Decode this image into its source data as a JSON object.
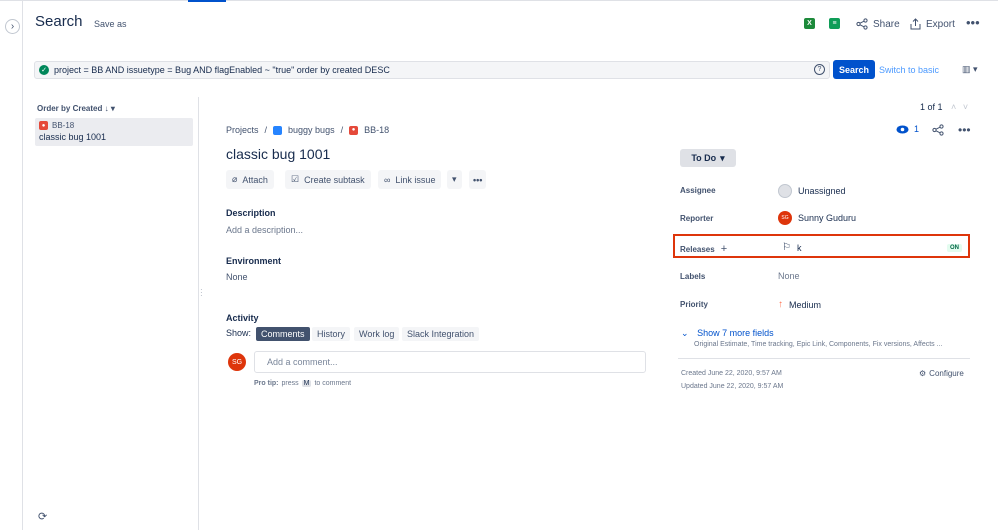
{
  "header": {
    "title": "Search",
    "save_as": "Save as",
    "share": "Share",
    "export": "Export"
  },
  "jql": {
    "query": "project = BB AND issuetype = Bug AND flagEnabled ~ \"true\" order by created DESC",
    "search_label": "Search",
    "switch_label": "Switch to basic"
  },
  "list": {
    "order_by": "Order by Created",
    "items": [
      {
        "key": "BB-18",
        "summary": "classic bug 1001"
      }
    ]
  },
  "pagination": "1 of 1",
  "issue": {
    "breadcrumb": [
      "Projects",
      "buggy bugs",
      "BB-18"
    ],
    "title": "classic bug 1001",
    "watchers": "1",
    "actions": {
      "attach": "Attach",
      "create_subtask": "Create subtask",
      "link_issue": "Link issue"
    },
    "description_label": "Description",
    "description_placeholder": "Add a description...",
    "environment_label": "Environment",
    "environment_value": "None",
    "activity_label": "Activity",
    "show_label": "Show:",
    "tabs": [
      "Comments",
      "History",
      "Work log",
      "Slack Integration"
    ],
    "comment_placeholder": "Add a comment...",
    "protip_prefix": "Pro tip:",
    "protip_press": "press",
    "protip_key": "M",
    "protip_suffix": "to comment",
    "user_initials": "SG"
  },
  "sidebar": {
    "status": "To Do",
    "assignee_label": "Assignee",
    "assignee_value": "Unassigned",
    "reporter_label": "Reporter",
    "reporter_value": "Sunny Guduru",
    "reporter_initials": "SG",
    "releases_label": "Releases",
    "releases_value": "k",
    "releases_badge": "ON",
    "labels_label": "Labels",
    "labels_value": "None",
    "priority_label": "Priority",
    "priority_value": "Medium",
    "show_more": "Show 7 more fields",
    "show_more_desc": "Original Estimate, Time tracking, Epic Link, Components, Fix versions, Affects ...",
    "created": "Created June 22, 2020, 9:57 AM",
    "updated": "Updated June 22, 2020, 9:57 AM",
    "configure": "Configure"
  },
  "colors": {
    "primary": "#0052cc",
    "highlight_border": "#de350b",
    "bug": "#e5493a",
    "success": "#00875a"
  }
}
